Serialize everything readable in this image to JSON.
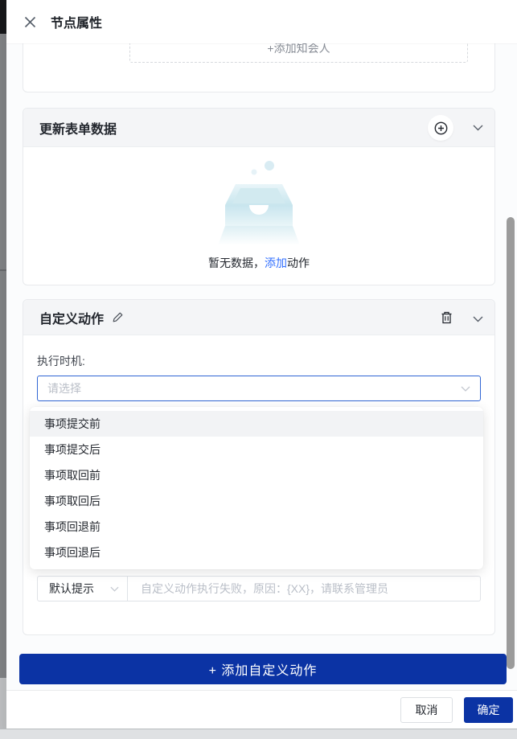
{
  "header": {
    "title": "节点属性"
  },
  "cc_section": {
    "add_button": "+添加知会人"
  },
  "update_form_section": {
    "title": "更新表单数据",
    "empty_text_prefix": "暂无数据，",
    "empty_link_text": "添加",
    "empty_text_suffix": "动作"
  },
  "custom_action_section": {
    "title": "自定义动作",
    "timing_label": "执行时机:",
    "timing_placeholder": "请选择",
    "timing_options": [
      "事项提交前",
      "事项提交后",
      "事项取回前",
      "事项取回后",
      "事项回退前",
      "事项回退后"
    ],
    "tip_select_value": "默认提示",
    "tip_input_placeholder": "自定义动作执行失败，原因：{XX}，请联系管理员"
  },
  "add_custom_action_button": "+ 添加自定义动作",
  "footer": {
    "cancel_button": "取消",
    "confirm_button": "确定"
  },
  "colors": {
    "primary_blue": "#0b33a4",
    "link_blue": "#3370ff",
    "focus_border": "#3166d4"
  }
}
